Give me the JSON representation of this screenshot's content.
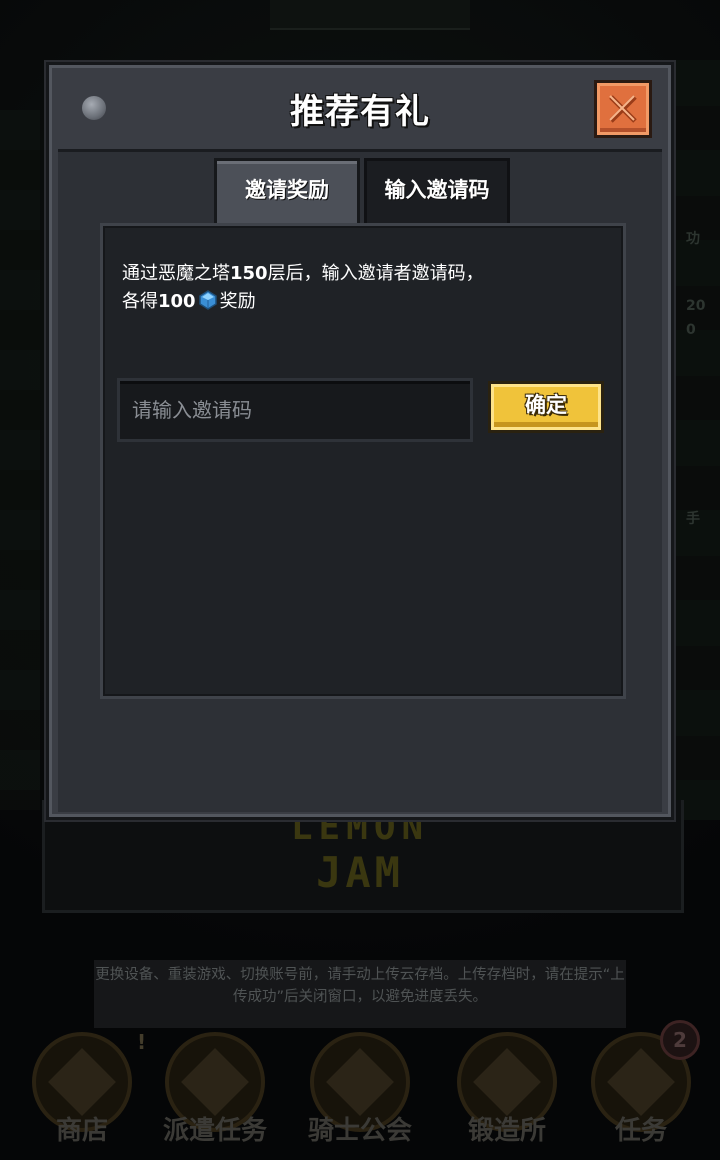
{
  "dialog": {
    "title": "推荐有礼",
    "close_label": "关闭",
    "tabs": [
      {
        "label": "邀请奖励",
        "active": true
      },
      {
        "label": "输入邀请码",
        "active": false
      }
    ],
    "info": {
      "line1_prefix": "通过恶魔之塔",
      "line1_floor": "150",
      "line1_suffix": "层后，输入邀请者邀请码，",
      "line2_prefix": "各得",
      "line2_amount": "100",
      "line2_suffix": "奖励",
      "reward_icon": "blue-gem-icon"
    },
    "code_input": {
      "value": "",
      "placeholder": "请输入邀请码"
    },
    "confirm_label": "确定"
  },
  "background": {
    "logo_line1": "LEMON",
    "logo_line2": "JAM",
    "notice": "更换设备、重装游戏、切换账号前，请手动上传云存档。上传存档时，请在提示“上传成功”后关闭窗口，以避免进度丢失。",
    "right_side_labels": [
      "功",
      "20",
      "0",
      "手"
    ],
    "nav": [
      {
        "label": "商店",
        "icon": "shop-icon",
        "alert": "!"
      },
      {
        "label": "派遣任务",
        "icon": "dispatch-icon"
      },
      {
        "label": "骑士公会",
        "icon": "guild-icon"
      },
      {
        "label": "锻造所",
        "icon": "forge-icon"
      },
      {
        "label": "任务",
        "icon": "quest-icon",
        "badge": "2"
      }
    ]
  },
  "colors": {
    "close_button": "#e0703e",
    "confirm_button": "#f0c33a",
    "panel": "#1f2226",
    "dialog": "#3a3d44",
    "gem": "#5ab4f0"
  }
}
